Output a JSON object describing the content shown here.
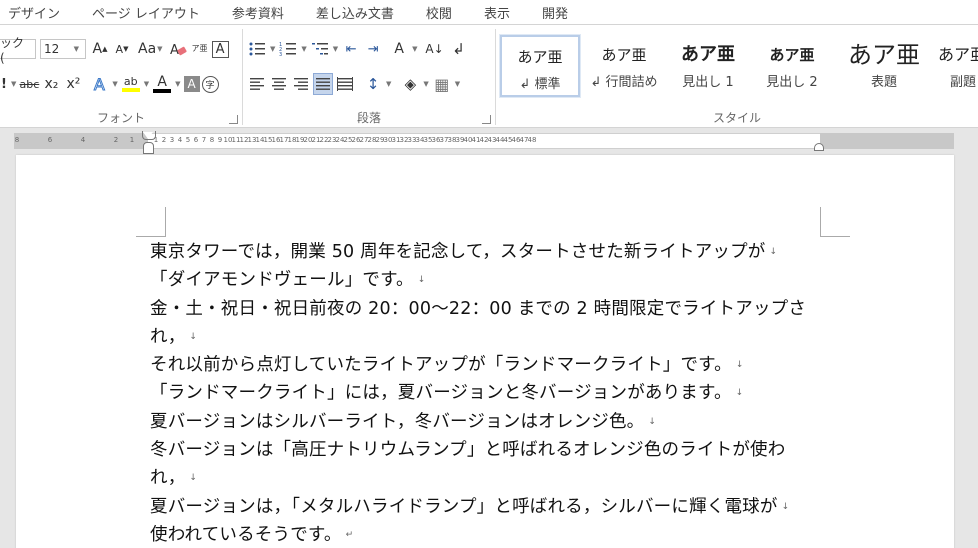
{
  "ribbon": {
    "tabs": [
      "デザイン",
      "ページ レイアウト",
      "参考資料",
      "差し込み文書",
      "校閲",
      "表示",
      "開発"
    ],
    "font": {
      "name": "ック (",
      "size": "12",
      "grow": "A",
      "shrink": "A",
      "change_case": "Aa",
      "phonetic": "ア亜",
      "border_char": "A",
      "strike": "abc",
      "sub": "x₂",
      "sup": "x²",
      "effects": "A",
      "highlight": "ab",
      "color": "A",
      "shade": "A",
      "enclose": "字",
      "group_label": "フォント"
    },
    "paragraph": {
      "bullets": "☰",
      "numbering": "☰",
      "multilevel": "☰",
      "decrease_indent": "⇤",
      "increase_indent": "⇥",
      "char_scaling": "A",
      "sort": "A↓",
      "edit_mark": "↲",
      "line_spacing": "↕",
      "shading": "◈",
      "borders": "▦",
      "group_label": "段落"
    },
    "styles": {
      "items": [
        {
          "sample": "あア亜",
          "name": "↲ 標準",
          "selected": true
        },
        {
          "sample": "あア亜",
          "name": "↲ 行間詰め",
          "selected": false
        },
        {
          "sample": "あア亜",
          "name": "見出し 1",
          "selected": false
        },
        {
          "sample": "あア亜",
          "name": "見出し 2",
          "selected": false
        },
        {
          "sample": "あア亜",
          "name": "表題",
          "selected": false
        },
        {
          "sample": "あア亜",
          "name": "副題",
          "selected": false
        }
      ],
      "group_label": "スタイル"
    },
    "colors": {
      "highlight": "#ffff00",
      "font_color": "#000000",
      "accent": "#2b579a"
    }
  },
  "ruler": {
    "numbers": [
      "8",
      "6",
      "4",
      "2",
      "1",
      "2",
      "4",
      "6",
      "8",
      "10",
      "12",
      "14",
      "16",
      "18",
      "20",
      "22",
      "24",
      "26",
      "28",
      "30",
      "32",
      "34",
      "36",
      "38",
      "40",
      "42",
      "44",
      "46",
      "48"
    ],
    "numbers_b": [
      "7",
      "5",
      "3",
      "1",
      "1",
      "3",
      "5",
      "7",
      "9",
      "11",
      "13",
      "15",
      "17",
      "19",
      "21",
      "23",
      "25",
      "27",
      "29",
      "31",
      "33",
      "35",
      "37",
      "39",
      "41",
      "43",
      "45",
      "47"
    ]
  },
  "document": {
    "lines": [
      "東京タワーでは，開業 50 周年を記念して，スタートさせた新ライトアップが",
      "「ダイアモンドヴェール」です。",
      "金・土・祝日・祝日前夜の 20：00〜22：00 までの 2 時間限定でライトアップさ",
      "れ，",
      "それ以前から点灯していたライトアップが「ランドマークライト」です。",
      "「ランドマークライト」には，夏バージョンと冬バージョンがあります。",
      "夏バージョンはシルバーライト，冬バージョンはオレンジ色。",
      "冬バージョンは「高圧ナトリウムランプ」と呼ばれるオレンジ色のライトが使わ",
      "れ，",
      "夏バージョンは，「メタルハライドランプ」と呼ばれる，シルバーに輝く電球が",
      "使われているそうです。"
    ],
    "marks": [
      "↓",
      "↓",
      "",
      "↓",
      "↓",
      "↓",
      "↓",
      "",
      "↓",
      "↓",
      "↵"
    ]
  }
}
